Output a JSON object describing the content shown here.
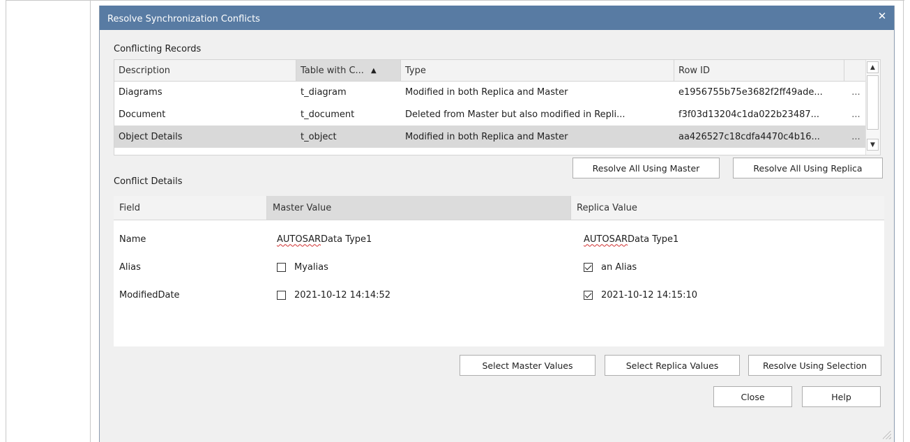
{
  "window": {
    "title": "Resolve Synchronization Conflicts",
    "close_glyph": "✕"
  },
  "records": {
    "label": "Conflicting Records",
    "columns": [
      "Description",
      "Table with C...",
      "Type",
      "Row ID"
    ],
    "sort_glyph": "▲",
    "rows": [
      {
        "description": "Diagrams",
        "table": "t_diagram",
        "type": "Modified in both Replica and Master",
        "row_id": "e1956755b75e3682f2ff49ade...",
        "more": "...",
        "selected": false
      },
      {
        "description": "Document",
        "table": "t_document",
        "type": "Deleted from Master but also modified in Repli...",
        "row_id": "f3f03d13204c1da022b23487...",
        "more": "...",
        "selected": false
      },
      {
        "description": "Object Details",
        "table": "t_object",
        "type": "Modified in both Replica and Master",
        "row_id": "aa426527c18cdfa4470c4b16...",
        "more": "...",
        "selected": true
      }
    ],
    "scroll_up_glyph": "▲",
    "scroll_down_glyph": "▼"
  },
  "buttons": {
    "resolve_all_master": "Resolve All Using Master",
    "resolve_all_replica": "Resolve All Using Replica",
    "select_master": "Select Master Values",
    "select_replica": "Select Replica Values",
    "resolve_selection": "Resolve Using Selection",
    "close": "Close",
    "help": "Help"
  },
  "details": {
    "label": "Conflict Details",
    "columns": [
      "Field",
      "Master Value",
      "Replica Value"
    ],
    "rows": [
      {
        "field": "Name",
        "master_prefix": "AUTOSAR",
        "master_rest": " Data Type1",
        "replica_prefix": "AUTOSAR",
        "replica_rest": " Data Type1",
        "has_checkbox": false
      },
      {
        "field": "Alias",
        "master": "Myalias",
        "master_checked": false,
        "replica": "an Alias",
        "replica_checked": true,
        "has_checkbox": true
      },
      {
        "field": "ModifiedDate",
        "master": "2021-10-12 14:14:52",
        "master_checked": false,
        "replica": "2021-10-12 14:15:10",
        "replica_checked": true,
        "has_checkbox": true
      }
    ]
  }
}
